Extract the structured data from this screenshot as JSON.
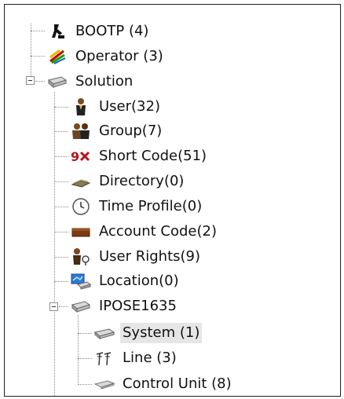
{
  "tree": {
    "bootp": {
      "label": "BOOTP (4)",
      "icon": "bootp-icon"
    },
    "operator": {
      "label": "Operator (3)",
      "icon": "operator-icon"
    },
    "solution": {
      "label": "Solution",
      "icon": "server-icon",
      "expanded": true,
      "children": {
        "user": {
          "label": "User(32)",
          "icon": "user-icon"
        },
        "group": {
          "label": "Group(7)",
          "icon": "group-icon"
        },
        "short_code": {
          "label": "Short Code(51)",
          "icon": "short-code-icon"
        },
        "directory": {
          "label": "Directory(0)",
          "icon": "directory-icon"
        },
        "time_profile": {
          "label": "Time Profile(0)",
          "icon": "clock-icon"
        },
        "account_code": {
          "label": "Account Code(2)",
          "icon": "account-code-icon"
        },
        "user_rights": {
          "label": "User Rights(9)",
          "icon": "user-rights-icon"
        },
        "location": {
          "label": "Location(0)",
          "icon": "location-icon"
        },
        "ipose": {
          "label": "IPOSE1635",
          "icon": "server-icon",
          "expanded": true,
          "children": {
            "system": {
              "label": "System (1)",
              "icon": "system-icon",
              "selected": true
            },
            "line": {
              "label": "Line (3)",
              "icon": "line-icon"
            },
            "control_unit": {
              "label": "Control Unit (8)",
              "icon": "control-unit-icon"
            }
          }
        }
      }
    }
  },
  "colors": {
    "selection": "#e6e6e6",
    "connector": "#8a8a8a",
    "border": "#1f1f1f"
  }
}
